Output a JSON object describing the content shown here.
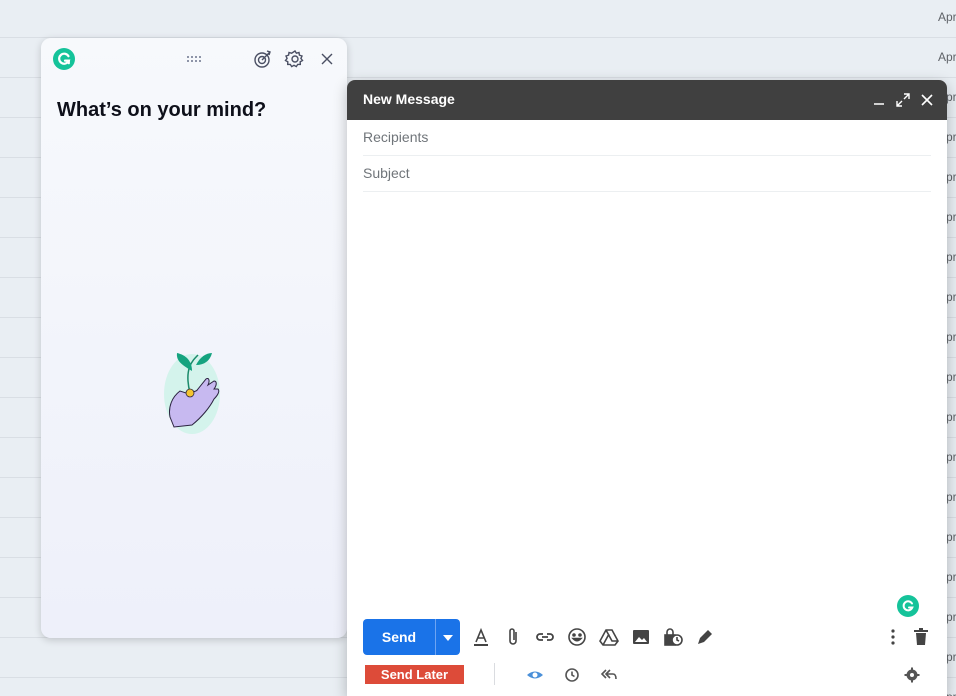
{
  "inbox": {
    "row_dates": [
      "Apr",
      "Apr",
      "Apr",
      "Apr",
      "Apr",
      "Apr",
      "Apr",
      "Apr",
      "Apr",
      "Apr",
      "Apr",
      "Apr",
      "Apr",
      "Apr",
      "Apr",
      "Apr",
      "Apr",
      "Apr"
    ]
  },
  "grammarly": {
    "title": "What’s on your mind?",
    "icons": [
      "grammarly-logo-icon",
      "drag-handle-icon",
      "goals-icon",
      "settings-icon",
      "close-icon"
    ],
    "colors": {
      "brand": "#15c39a"
    }
  },
  "compose": {
    "title": "New Message",
    "recipients_placeholder": "Recipients",
    "subject_placeholder": "Subject",
    "send_label": "Send",
    "send_later_label": "Send Later",
    "header_icons": [
      "minimize-icon",
      "fullscreen-icon",
      "close-icon"
    ],
    "toolbar_icons": [
      "formatting-icon",
      "attach-icon",
      "link-icon",
      "emoji-icon",
      "drive-icon",
      "photo-icon",
      "confidential-icon",
      "signature-icon",
      "more-options-icon",
      "delete-icon"
    ],
    "colors": {
      "header": "#404040",
      "send": "#1a73e8",
      "send_later": "#dd4b39"
    }
  }
}
